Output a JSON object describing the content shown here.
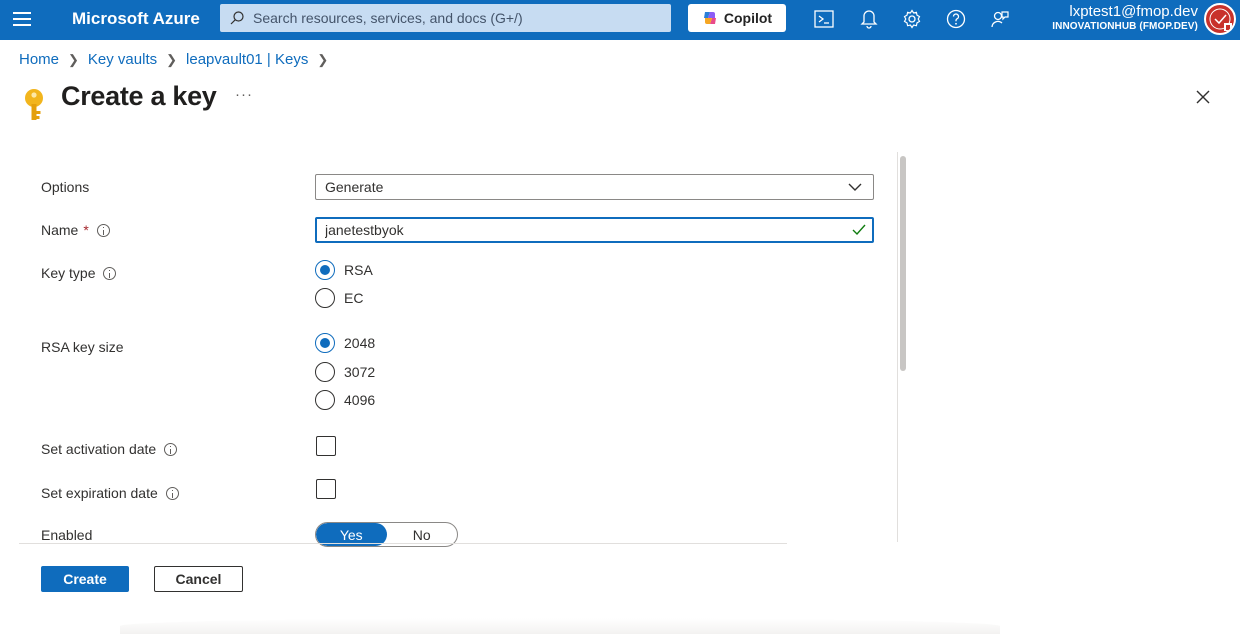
{
  "topbar": {
    "brand": "Microsoft Azure",
    "search_placeholder": "Search resources, services, and docs (G+/)",
    "copilot_label": "Copilot",
    "user_email": "lxptest1@fmop.dev",
    "user_tenant": "INNOVATIONHUB (FMOP.DEV)",
    "icons": [
      "hamburger-icon",
      "cloud-shell-icon",
      "notifications-icon",
      "settings-icon",
      "help-icon",
      "feedback-icon"
    ]
  },
  "breadcrumb": {
    "items": [
      "Home",
      "Key vaults",
      "leapvault01 | Keys"
    ]
  },
  "header": {
    "title": "Create a key",
    "more": "···"
  },
  "form": {
    "options": {
      "label": "Options",
      "value": "Generate"
    },
    "name": {
      "label": "Name",
      "required_mark": "*",
      "value": "janetestbyok"
    },
    "key_type": {
      "label": "Key type",
      "options": [
        "RSA",
        "EC"
      ],
      "selected": "RSA"
    },
    "rsa_key_size": {
      "label": "RSA key size",
      "options": [
        "2048",
        "3072",
        "4096"
      ],
      "selected": "2048"
    },
    "activation": {
      "label": "Set activation date",
      "checked": false
    },
    "expiration": {
      "label": "Set expiration date",
      "checked": false
    },
    "enabled": {
      "label": "Enabled",
      "options": [
        "Yes",
        "No"
      ],
      "selected": "Yes"
    }
  },
  "actions": {
    "create_label": "Create",
    "cancel_label": "Cancel"
  },
  "colors": {
    "azure_blue": "#0f6cbd",
    "success_green": "#107c10",
    "required_red": "#a4262c"
  }
}
